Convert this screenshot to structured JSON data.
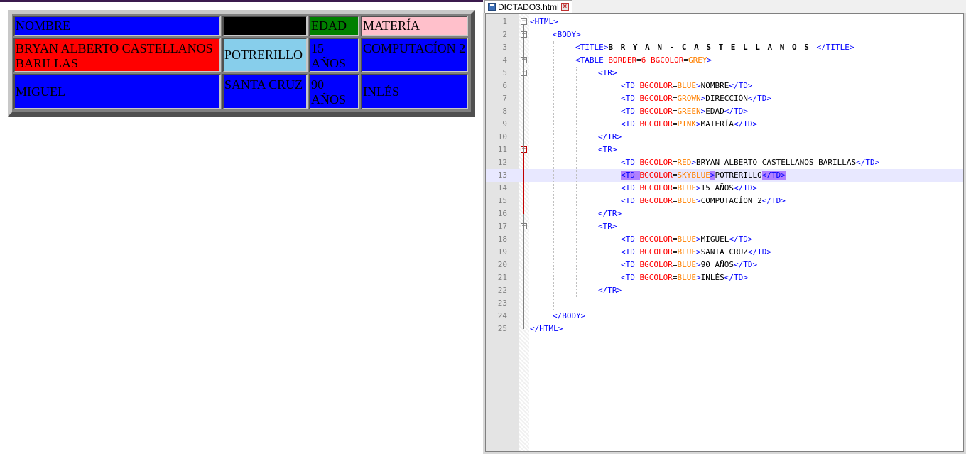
{
  "preview": {
    "table": {
      "rows": [
        [
          {
            "text": "NOMBRE",
            "bg": "#0000ff"
          },
          {
            "text": "",
            "bg": "#000000"
          },
          {
            "text": "EDAD",
            "bg": "#008000"
          },
          {
            "text": "MATERÍA",
            "bg": "#ffc0cb"
          }
        ],
        [
          {
            "text": "BRYAN ALBERTO CASTELLANOS BARILLAS",
            "bg": "#ff0000"
          },
          {
            "text": "POTRERILLO",
            "bg": "#87ceeb"
          },
          {
            "text": "15 AÑOS",
            "bg": "#0000ff"
          },
          {
            "text": "COMPUTACÍON 2",
            "bg": "#0000ff"
          }
        ],
        [
          {
            "text": "MIGUEL",
            "bg": "#0000ff"
          },
          {
            "text": "SANTA CRUZ",
            "bg": "#0000ff"
          },
          {
            "text": "90 AÑOS",
            "bg": "#0000ff"
          },
          {
            "text": "INLÉS",
            "bg": "#0000ff"
          }
        ]
      ]
    }
  },
  "editor": {
    "tab": {
      "label": "DICTADO3.html",
      "icon": "save-icon",
      "close": "close-icon"
    },
    "current_line": 13,
    "lines": [
      {
        "n": "1",
        "indent": 0,
        "fold": "minus",
        "tokens": [
          [
            "tag",
            "<HTML>"
          ]
        ]
      },
      {
        "n": "2",
        "indent": 1,
        "fold": "minus",
        "tokens": [
          [
            "tag",
            "<BODY>"
          ]
        ]
      },
      {
        "n": "3",
        "indent": 2,
        "fold": "",
        "tokens": [
          [
            "tag",
            "<TITLE>"
          ],
          [
            "title",
            "B R Y A N - C A S T E L L A N O S "
          ],
          [
            "tag",
            "</TITLE>"
          ]
        ]
      },
      {
        "n": "4",
        "indent": 2,
        "fold": "minus",
        "tokens": [
          [
            "tag",
            "<TABLE "
          ],
          [
            "attr",
            "BORDER"
          ],
          [
            "eq",
            "="
          ],
          [
            "attr",
            "6 "
          ],
          [
            "attr",
            "BGCOLOR"
          ],
          [
            "eq",
            "="
          ],
          [
            "val",
            "GREY"
          ],
          [
            "tag",
            ">"
          ]
        ]
      },
      {
        "n": "5",
        "indent": 3,
        "fold": "minus",
        "tokens": [
          [
            "tag",
            "<TR>"
          ]
        ]
      },
      {
        "n": "6",
        "indent": 4,
        "fold": "",
        "tokens": [
          [
            "tag",
            "<TD "
          ],
          [
            "attr",
            "BGCOLOR"
          ],
          [
            "eq",
            "="
          ],
          [
            "val",
            "BLUE"
          ],
          [
            "tag",
            ">"
          ],
          [
            "text",
            "NOMBRE"
          ],
          [
            "tag",
            "</TD>"
          ]
        ]
      },
      {
        "n": "7",
        "indent": 4,
        "fold": "",
        "tokens": [
          [
            "tag",
            "<TD "
          ],
          [
            "attr",
            "BGCOLOR"
          ],
          [
            "eq",
            "="
          ],
          [
            "val",
            "GROWN"
          ],
          [
            "tag",
            ">"
          ],
          [
            "text",
            "DIRECCIÓN"
          ],
          [
            "tag",
            "</TD>"
          ]
        ]
      },
      {
        "n": "8",
        "indent": 4,
        "fold": "",
        "tokens": [
          [
            "tag",
            "<TD "
          ],
          [
            "attr",
            "BGCOLOR"
          ],
          [
            "eq",
            "="
          ],
          [
            "val",
            "GREEN"
          ],
          [
            "tag",
            ">"
          ],
          [
            "text",
            "EDAD"
          ],
          [
            "tag",
            "</TD>"
          ]
        ]
      },
      {
        "n": "9",
        "indent": 4,
        "fold": "",
        "tokens": [
          [
            "tag",
            "<TD "
          ],
          [
            "attr",
            "BGCOLOR"
          ],
          [
            "eq",
            "="
          ],
          [
            "val",
            "PINK"
          ],
          [
            "tag",
            ">"
          ],
          [
            "text",
            "MATERÍA"
          ],
          [
            "tag",
            "</TD>"
          ]
        ]
      },
      {
        "n": "10",
        "indent": 3,
        "fold": "",
        "tokens": [
          [
            "tag",
            "</TR>"
          ]
        ]
      },
      {
        "n": "11",
        "indent": 3,
        "fold": "minus-red",
        "tokens": [
          [
            "tag",
            "<TR>"
          ]
        ]
      },
      {
        "n": "12",
        "indent": 4,
        "fold": "",
        "tokens": [
          [
            "tag",
            "<TD "
          ],
          [
            "attr",
            "BGCOLOR"
          ],
          [
            "eq",
            "="
          ],
          [
            "val",
            "RED"
          ],
          [
            "tag",
            ">"
          ],
          [
            "text",
            "BRYAN ALBERTO CASTELLANOS BARILLAS"
          ],
          [
            "tag",
            "</TD>"
          ]
        ]
      },
      {
        "n": "13",
        "indent": 4,
        "fold": "",
        "tokens": [
          [
            "hltag",
            "<TD "
          ],
          [
            "attr",
            "BGCOLOR"
          ],
          [
            "eq",
            "="
          ],
          [
            "val",
            "SKYBLUE"
          ],
          [
            "hltag",
            ">"
          ],
          [
            "text",
            "POTRERILLO"
          ],
          [
            "hltag",
            "</TD>"
          ]
        ]
      },
      {
        "n": "14",
        "indent": 4,
        "fold": "",
        "tokens": [
          [
            "tag",
            "<TD "
          ],
          [
            "attr",
            "BGCOLOR"
          ],
          [
            "eq",
            "="
          ],
          [
            "val",
            "BLUE"
          ],
          [
            "tag",
            ">"
          ],
          [
            "text",
            "15 AÑOS"
          ],
          [
            "tag",
            "</TD>"
          ]
        ]
      },
      {
        "n": "15",
        "indent": 4,
        "fold": "",
        "tokens": [
          [
            "tag",
            "<TD "
          ],
          [
            "attr",
            "BGCOLOR"
          ],
          [
            "eq",
            "="
          ],
          [
            "val",
            "BLUE"
          ],
          [
            "tag",
            ">"
          ],
          [
            "text",
            "COMPUTACÍON 2"
          ],
          [
            "tag",
            "</TD>"
          ]
        ]
      },
      {
        "n": "16",
        "indent": 3,
        "fold": "",
        "tokens": [
          [
            "tag",
            "</TR>"
          ]
        ]
      },
      {
        "n": "17",
        "indent": 3,
        "fold": "minus",
        "tokens": [
          [
            "tag",
            "<TR>"
          ]
        ]
      },
      {
        "n": "18",
        "indent": 4,
        "fold": "",
        "tokens": [
          [
            "tag",
            "<TD "
          ],
          [
            "attr",
            "BGCOLOR"
          ],
          [
            "eq",
            "="
          ],
          [
            "val",
            "BLUE"
          ],
          [
            "tag",
            ">"
          ],
          [
            "text",
            "MIGUEL"
          ],
          [
            "tag",
            "</TD>"
          ]
        ]
      },
      {
        "n": "19",
        "indent": 4,
        "fold": "",
        "tokens": [
          [
            "tag",
            "<TD "
          ],
          [
            "attr",
            "BGCOLOR"
          ],
          [
            "eq",
            "="
          ],
          [
            "val",
            "BLUE"
          ],
          [
            "tag",
            ">"
          ],
          [
            "text",
            "SANTA CRUZ"
          ],
          [
            "tag",
            "</TD>"
          ]
        ]
      },
      {
        "n": "20",
        "indent": 4,
        "fold": "",
        "tokens": [
          [
            "tag",
            "<TD "
          ],
          [
            "attr",
            "BGCOLOR"
          ],
          [
            "eq",
            "="
          ],
          [
            "val",
            "BLUE"
          ],
          [
            "tag",
            ">"
          ],
          [
            "text",
            "90 AÑOS"
          ],
          [
            "tag",
            "</TD>"
          ]
        ]
      },
      {
        "n": "21",
        "indent": 4,
        "fold": "",
        "tokens": [
          [
            "tag",
            "<TD "
          ],
          [
            "attr",
            "BGCOLOR"
          ],
          [
            "eq",
            "="
          ],
          [
            "val",
            "BLUE"
          ],
          [
            "tag",
            ">"
          ],
          [
            "text",
            "INLÉS"
          ],
          [
            "tag",
            "</TD>"
          ]
        ]
      },
      {
        "n": "22",
        "indent": 3,
        "fold": "",
        "tokens": [
          [
            "tag",
            "</TR>"
          ]
        ]
      },
      {
        "n": "23",
        "indent": 0,
        "fold": "",
        "tokens": []
      },
      {
        "n": "24",
        "indent": 1,
        "fold": "",
        "tokens": [
          [
            "tag",
            "</BODY>"
          ]
        ]
      },
      {
        "n": "25",
        "indent": 0,
        "fold": "",
        "tokens": [
          [
            "tag",
            "</HTML>"
          ]
        ]
      }
    ]
  }
}
